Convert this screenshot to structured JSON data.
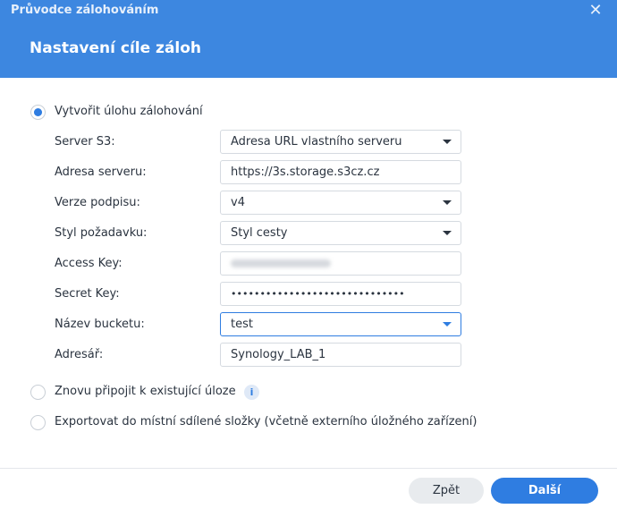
{
  "window": {
    "title": "Průvodce zálohováním",
    "close_icon": "close-icon"
  },
  "page": {
    "title": "Nastavení cíle záloh"
  },
  "options": {
    "create_task": {
      "label": "Vytvořit úlohu zálohování",
      "checked": true
    },
    "reconnect": {
      "label": "Znovu připojit k existující úloze",
      "checked": false,
      "info_icon": "info-icon"
    },
    "export": {
      "label": "Exportovat do místní sdílené složky (včetně externího úložného zařízení)",
      "checked": false
    }
  },
  "form": {
    "s3_server": {
      "label": "Server S3:",
      "value": "Adresa URL vlastního serveru"
    },
    "server_address": {
      "label": "Adresa serveru:",
      "value": "https://3s.storage.s3cz.cz"
    },
    "signature_version": {
      "label": "Verze podpisu:",
      "value": "v4"
    },
    "request_style": {
      "label": "Styl požadavku:",
      "value": "Styl cesty"
    },
    "access_key": {
      "label": "Access Key:",
      "value": ""
    },
    "secret_key": {
      "label": "Secret Key:",
      "value": "••••••••••••••••••••••••••••••"
    },
    "bucket_name": {
      "label": "Název bucketu:",
      "value": "test"
    },
    "directory": {
      "label": "Adresář:",
      "value": "Synology_LAB_1"
    }
  },
  "footer": {
    "back_label": "Zpět",
    "next_label": "Další"
  },
  "colors": {
    "header": "#3d87e0",
    "accent": "#2f7de1",
    "secondary_button": "#e8ebee"
  }
}
